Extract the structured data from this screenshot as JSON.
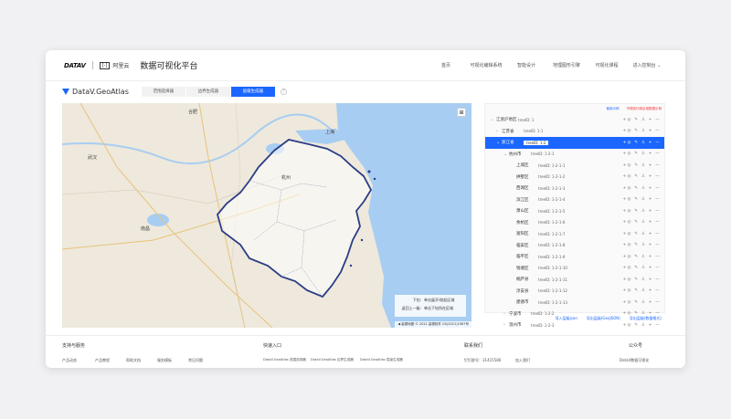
{
  "header": {
    "brand_logo": "DATAV",
    "aliyun_mark": "[-]",
    "aliyun_label": "阿里云",
    "platform_title": "数据可视化平台",
    "nav": [
      "首页",
      "可视化编辑系统",
      "智能设计",
      "地理图形引擎",
      "可视化课程",
      "进入控制台 ⌄"
    ]
  },
  "subheader": {
    "product_name": "DataV.GeoAtlas",
    "tabs": [
      "范围选择器",
      "边界生成器",
      "层级生成器"
    ],
    "active_tab": 2,
    "help_icon": "?"
  },
  "map": {
    "labels": [
      {
        "text": "合肥"
      },
      {
        "text": "上海"
      },
      {
        "text": "武汉"
      },
      {
        "text": "南昌"
      },
      {
        "text": "杭州"
      }
    ],
    "control_icon": "fullscreen-icon",
    "control_glyph": "⊞",
    "legend": [
      {
        "key": "下钻:",
        "desc": "单击展开/收起区域"
      },
      {
        "key": "返回上一级:",
        "desc": "单击下钻所在区域"
      }
    ],
    "copyright": "◀ 高德地图 © 2022 高德软件 GS(2021)1987号"
  },
  "tree": {
    "header_links": [
      {
        "label": "使用示例",
        "color": "#1a66ff"
      },
      {
        "label": "不规则行政区域数据示例",
        "color": "#ee3333"
      }
    ],
    "rows": [
      {
        "caret": "⌄",
        "name": "江浙沪地区",
        "tid": "treeID: 1",
        "depth": 0,
        "selected": false
      },
      {
        "caret": "›",
        "name": "江苏省",
        "tid": "treeID: 1-1",
        "depth": 1,
        "selected": false
      },
      {
        "caret": "⌄",
        "name": "浙江省",
        "tid": "treeID: 1-2",
        "depth": 1,
        "selected": true
      },
      {
        "caret": "⌄",
        "name": "杭州市",
        "tid": "treeID: 1-2-1",
        "depth": 2,
        "selected": false
      },
      {
        "caret": "",
        "name": "上城区",
        "tid": "treeID: 1-2-1-1",
        "depth": 3,
        "selected": false
      },
      {
        "caret": "",
        "name": "拱墅区",
        "tid": "treeID: 1-2-1-2",
        "depth": 3,
        "selected": false
      },
      {
        "caret": "",
        "name": "西湖区",
        "tid": "treeID: 1-2-1-3",
        "depth": 3,
        "selected": false
      },
      {
        "caret": "",
        "name": "滨江区",
        "tid": "treeID: 1-2-1-4",
        "depth": 3,
        "selected": false
      },
      {
        "caret": "",
        "name": "萧山区",
        "tid": "treeID: 1-2-1-5",
        "depth": 3,
        "selected": false
      },
      {
        "caret": "",
        "name": "余杭区",
        "tid": "treeID: 1-2-1-6",
        "depth": 3,
        "selected": false
      },
      {
        "caret": "",
        "name": "富阳区",
        "tid": "treeID: 1-2-1-7",
        "depth": 3,
        "selected": false
      },
      {
        "caret": "",
        "name": "临安区",
        "tid": "treeID: 1-2-1-8",
        "depth": 3,
        "selected": false
      },
      {
        "caret": "",
        "name": "临平区",
        "tid": "treeID: 1-2-1-9",
        "depth": 3,
        "selected": false
      },
      {
        "caret": "",
        "name": "钱塘区",
        "tid": "treeID: 1-2-1-10",
        "depth": 3,
        "selected": false
      },
      {
        "caret": "",
        "name": "桐庐县",
        "tid": "treeID: 1-2-1-11",
        "depth": 3,
        "selected": false
      },
      {
        "caret": "",
        "name": "淳安县",
        "tid": "treeID: 1-2-1-12",
        "depth": 3,
        "selected": false
      },
      {
        "caret": "",
        "name": "建德市",
        "tid": "treeID: 1-2-1-13",
        "depth": 3,
        "selected": false
      },
      {
        "caret": "›",
        "name": "宁波市",
        "tid": "treeID: 1-2-2",
        "depth": 2,
        "selected": false
      },
      {
        "caret": "›",
        "name": "温州市",
        "tid": "treeID: 1-2-3",
        "depth": 2,
        "selected": false
      }
    ],
    "row_actions": "+◎ ✎ ♙ + —",
    "footer_links": [
      "导入层级json",
      "导出层级(GeoJSON)",
      "导出层级(数据格式)"
    ]
  },
  "footer": {
    "sections": [
      {
        "title": "支持与服务",
        "items": [
          "产品动态",
          "产品教程",
          "帮助文档",
          "服务模板",
          "常见问题"
        ]
      },
      {
        "title": "快速入口",
        "items": [
          "DataV.GeoAtlas 范围选择器",
          "DataV.GeoAtlas 边界生成器",
          "DataV.GeoAtlas 层级生成器"
        ]
      },
      {
        "title": "联系我们",
        "items": [
          "钉钉群号：31415586",
          "加入我们"
        ]
      },
      {
        "title": "公众号",
        "items": [
          "DataV数据可视化"
        ]
      }
    ]
  },
  "colors": {
    "accent": "#1a66ff",
    "water": "#a8cdf2",
    "land": "#eee9dc",
    "boundary": "#2a3d86",
    "highlight_fill": "#ffffff"
  }
}
